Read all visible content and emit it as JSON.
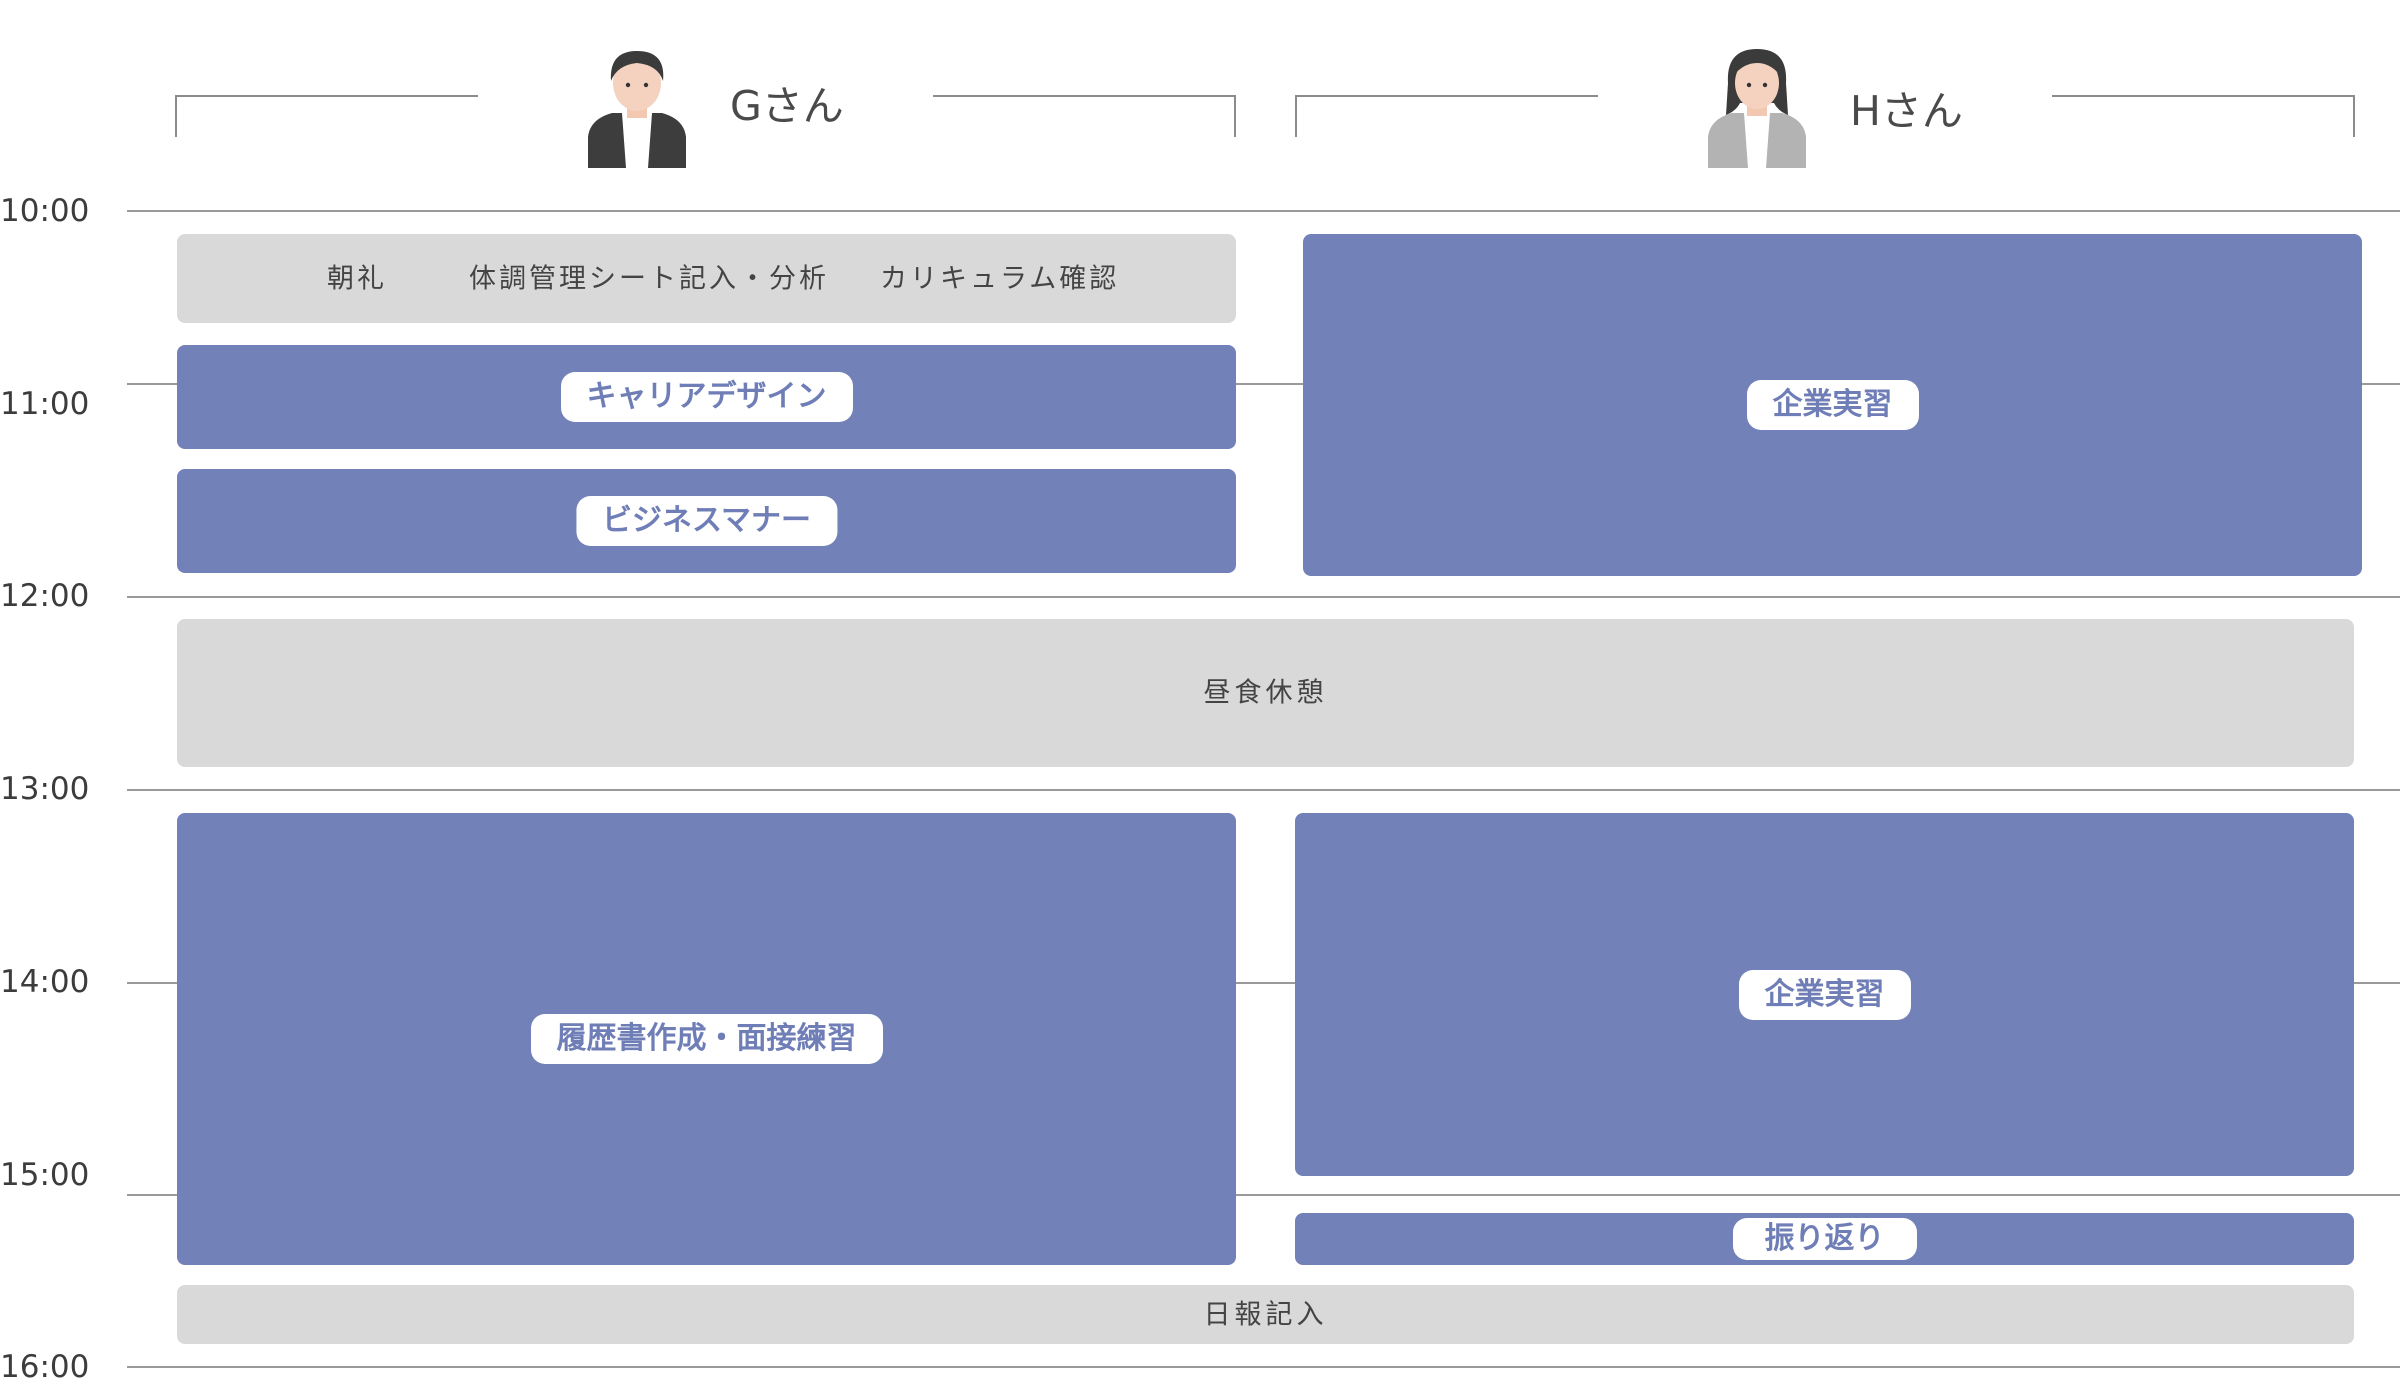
{
  "times": [
    "10:00",
    "11:00",
    "12:00",
    "13:00",
    "14:00",
    "15:00",
    "16:00"
  ],
  "people": [
    {
      "name": "Gさん"
    },
    {
      "name": "Hさん"
    }
  ],
  "g_morning": {
    "items": [
      "朝礼",
      "体調管理シート記入・分析",
      "カリキュラム確認"
    ]
  },
  "g_blocks": {
    "career_design": "キャリアデザイン",
    "business_manner": "ビジネスマナー",
    "resume_interview": "履歴書作成・面接練習"
  },
  "h_blocks": {
    "internship_am": "企業実習",
    "internship_pm": "企業実習",
    "reflection": "振り返り"
  },
  "shared": {
    "lunch": "昼食休憩",
    "daily_report": "日報記入"
  },
  "colors": {
    "session_blue": "#7281b8",
    "common_gray": "#d9d9d9",
    "pill_text": "#6f7eb6",
    "grid_line": "#9a9a9a"
  }
}
